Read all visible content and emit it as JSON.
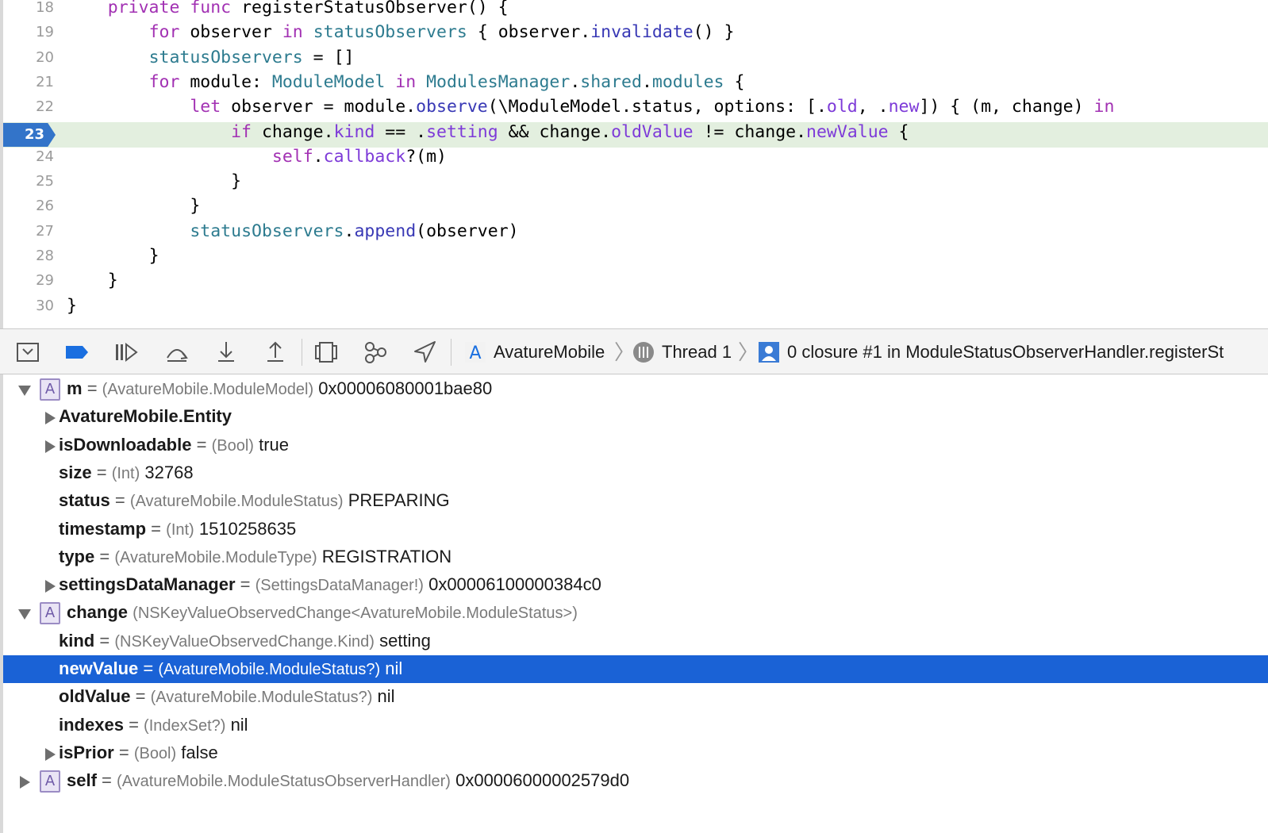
{
  "editor": {
    "current_line": "23",
    "lines": [
      {
        "num": "18",
        "indent": "    ",
        "tokens": [
          [
            "kw",
            "private"
          ],
          [
            "p",
            " "
          ],
          [
            "kw",
            "func"
          ],
          [
            "p",
            " registerStatusObserver() {"
          ]
        ]
      },
      {
        "num": "19",
        "indent": "        ",
        "tokens": [
          [
            "kw",
            "for"
          ],
          [
            "p",
            " observer "
          ],
          [
            "kw",
            "in"
          ],
          [
            "p",
            " "
          ],
          [
            "ty",
            "statusObservers"
          ],
          [
            "p",
            " { observer."
          ],
          [
            "mt",
            "invalidate"
          ],
          [
            "p",
            "() }"
          ]
        ]
      },
      {
        "num": "20",
        "indent": "        ",
        "tokens": [
          [
            "ty",
            "statusObservers"
          ],
          [
            "p",
            " = []"
          ]
        ]
      },
      {
        "num": "21",
        "indent": "        ",
        "tokens": [
          [
            "kw",
            "for"
          ],
          [
            "p",
            " module: "
          ],
          [
            "ty",
            "ModuleModel"
          ],
          [
            "p",
            " "
          ],
          [
            "kw",
            "in"
          ],
          [
            "p",
            " "
          ],
          [
            "ty",
            "ModulesManager"
          ],
          [
            "p",
            "."
          ],
          [
            "ty",
            "shared"
          ],
          [
            "p",
            "."
          ],
          [
            "ty",
            "modules"
          ],
          [
            "p",
            " {"
          ]
        ]
      },
      {
        "num": "22",
        "indent": "            ",
        "tokens": [
          [
            "kw",
            "let"
          ],
          [
            "p",
            " observer = module."
          ],
          [
            "mt",
            "observe"
          ],
          [
            "p",
            "(\\ModuleModel.status, options: [."
          ],
          [
            "pr",
            "old"
          ],
          [
            "p",
            ", ."
          ],
          [
            "pr",
            "new"
          ],
          [
            "p",
            "]) { (m, change) "
          ],
          [
            "kw",
            "in"
          ]
        ]
      },
      {
        "num": "23",
        "indent": "                ",
        "tokens": [
          [
            "kw",
            "if"
          ],
          [
            "p",
            " change."
          ],
          [
            "pr",
            "kind"
          ],
          [
            "p",
            " == ."
          ],
          [
            "pr",
            "setting"
          ],
          [
            "p",
            " && change."
          ],
          [
            "pr",
            "oldValue"
          ],
          [
            "p",
            " != change."
          ],
          [
            "pr",
            "newValue"
          ],
          [
            "p",
            " {"
          ]
        ]
      },
      {
        "num": "24",
        "indent": "                    ",
        "tokens": [
          [
            "kw",
            "self"
          ],
          [
            "p",
            "."
          ],
          [
            "pr",
            "callback"
          ],
          [
            "p",
            "?(m)"
          ]
        ]
      },
      {
        "num": "25",
        "indent": "                ",
        "tokens": [
          [
            "p",
            "}"
          ]
        ]
      },
      {
        "num": "26",
        "indent": "            ",
        "tokens": [
          [
            "p",
            "}"
          ]
        ]
      },
      {
        "num": "27",
        "indent": "            ",
        "tokens": [
          [
            "ty",
            "statusObservers"
          ],
          [
            "p",
            "."
          ],
          [
            "mt",
            "append"
          ],
          [
            "p",
            "(observer)"
          ]
        ]
      },
      {
        "num": "28",
        "indent": "        ",
        "tokens": [
          [
            "p",
            "}"
          ]
        ]
      },
      {
        "num": "29",
        "indent": "    ",
        "tokens": [
          [
            "p",
            "}"
          ]
        ]
      },
      {
        "num": "30",
        "indent": "",
        "tokens": [
          [
            "p",
            "}"
          ]
        ]
      }
    ]
  },
  "debug_bar": {
    "buttons": [
      "hide-debug-area-icon",
      "breakpoints-icon",
      "continue-icon",
      "step-over-icon",
      "step-into-icon",
      "step-out-icon",
      "view-debugger-icon",
      "memory-graph-icon",
      "simulate-location-icon"
    ],
    "breadcrumb": {
      "app": "AvatureMobile",
      "thread": "Thread 1",
      "frame": "0 closure #1 in ModuleStatusObserverHandler.registerSt"
    }
  },
  "variables": [
    {
      "depth": 0,
      "disclosure": "expanded",
      "badge": "A",
      "name": "m",
      "eq": "=",
      "type": "(AvatureMobile.ModuleModel)",
      "value": "0x00006080001bae80"
    },
    {
      "depth": 1,
      "disclosure": "collapsed",
      "badge": "",
      "name": "AvatureMobile.Entity",
      "eq": "",
      "type": "",
      "value": ""
    },
    {
      "depth": 1,
      "disclosure": "collapsed",
      "badge": "",
      "name": "isDownloadable",
      "eq": "=",
      "type": "(Bool)",
      "value": "true"
    },
    {
      "depth": 1,
      "disclosure": "none",
      "badge": "",
      "name": "size",
      "eq": "=",
      "type": "(Int)",
      "value": "32768"
    },
    {
      "depth": 1,
      "disclosure": "none",
      "badge": "",
      "name": "status",
      "eq": "=",
      "type": "(AvatureMobile.ModuleStatus)",
      "value": "PREPARING"
    },
    {
      "depth": 1,
      "disclosure": "none",
      "badge": "",
      "name": "timestamp",
      "eq": "=",
      "type": "(Int)",
      "value": "1510258635"
    },
    {
      "depth": 1,
      "disclosure": "none",
      "badge": "",
      "name": "type",
      "eq": "=",
      "type": "(AvatureMobile.ModuleType)",
      "value": "REGISTRATION"
    },
    {
      "depth": 1,
      "disclosure": "collapsed",
      "badge": "",
      "name": "settingsDataManager",
      "eq": "=",
      "type": "(SettingsDataManager!)",
      "value": "0x00006100000384c0"
    },
    {
      "depth": 0,
      "disclosure": "expanded",
      "badge": "A",
      "name": "change",
      "eq": "",
      "type": "(NSKeyValueObservedChange<AvatureMobile.ModuleStatus>)",
      "value": ""
    },
    {
      "depth": 1,
      "disclosure": "none",
      "badge": "",
      "name": "kind",
      "eq": "=",
      "type": "(NSKeyValueObservedChange.Kind)",
      "value": "setting"
    },
    {
      "depth": 1,
      "disclosure": "none",
      "badge": "",
      "name": "newValue",
      "eq": "=",
      "type": "(AvatureMobile.ModuleStatus?)",
      "value": "nil",
      "selected": true
    },
    {
      "depth": 1,
      "disclosure": "none",
      "badge": "",
      "name": "oldValue",
      "eq": "=",
      "type": "(AvatureMobile.ModuleStatus?)",
      "value": "nil"
    },
    {
      "depth": 1,
      "disclosure": "none",
      "badge": "",
      "name": "indexes",
      "eq": "=",
      "type": "(IndexSet?)",
      "value": "nil"
    },
    {
      "depth": 1,
      "disclosure": "collapsed",
      "badge": "",
      "name": "isPrior",
      "eq": "=",
      "type": "(Bool)",
      "value": "false"
    },
    {
      "depth": 0,
      "disclosure": "collapsed",
      "badge": "A",
      "name": "self",
      "eq": "=",
      "type": "(AvatureMobile.ModuleStatusObserverHandler)",
      "value": "0x00006000002579d0"
    }
  ]
}
